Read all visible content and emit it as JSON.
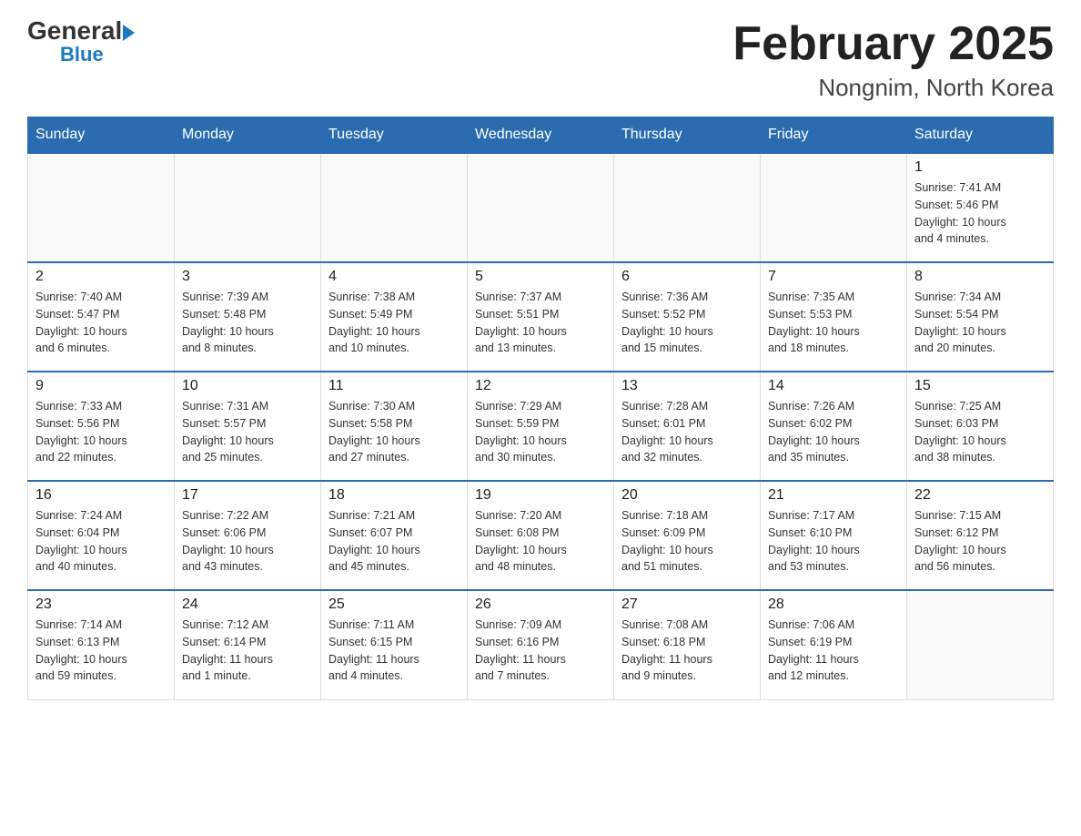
{
  "header": {
    "logo_general": "General",
    "logo_blue": "Blue",
    "month_title": "February 2025",
    "location": "Nongnim, North Korea"
  },
  "weekdays": [
    "Sunday",
    "Monday",
    "Tuesday",
    "Wednesday",
    "Thursday",
    "Friday",
    "Saturday"
  ],
  "weeks": [
    [
      {
        "day": "",
        "info": ""
      },
      {
        "day": "",
        "info": ""
      },
      {
        "day": "",
        "info": ""
      },
      {
        "day": "",
        "info": ""
      },
      {
        "day": "",
        "info": ""
      },
      {
        "day": "",
        "info": ""
      },
      {
        "day": "1",
        "info": "Sunrise: 7:41 AM\nSunset: 5:46 PM\nDaylight: 10 hours\nand 4 minutes."
      }
    ],
    [
      {
        "day": "2",
        "info": "Sunrise: 7:40 AM\nSunset: 5:47 PM\nDaylight: 10 hours\nand 6 minutes."
      },
      {
        "day": "3",
        "info": "Sunrise: 7:39 AM\nSunset: 5:48 PM\nDaylight: 10 hours\nand 8 minutes."
      },
      {
        "day": "4",
        "info": "Sunrise: 7:38 AM\nSunset: 5:49 PM\nDaylight: 10 hours\nand 10 minutes."
      },
      {
        "day": "5",
        "info": "Sunrise: 7:37 AM\nSunset: 5:51 PM\nDaylight: 10 hours\nand 13 minutes."
      },
      {
        "day": "6",
        "info": "Sunrise: 7:36 AM\nSunset: 5:52 PM\nDaylight: 10 hours\nand 15 minutes."
      },
      {
        "day": "7",
        "info": "Sunrise: 7:35 AM\nSunset: 5:53 PM\nDaylight: 10 hours\nand 18 minutes."
      },
      {
        "day": "8",
        "info": "Sunrise: 7:34 AM\nSunset: 5:54 PM\nDaylight: 10 hours\nand 20 minutes."
      }
    ],
    [
      {
        "day": "9",
        "info": "Sunrise: 7:33 AM\nSunset: 5:56 PM\nDaylight: 10 hours\nand 22 minutes."
      },
      {
        "day": "10",
        "info": "Sunrise: 7:31 AM\nSunset: 5:57 PM\nDaylight: 10 hours\nand 25 minutes."
      },
      {
        "day": "11",
        "info": "Sunrise: 7:30 AM\nSunset: 5:58 PM\nDaylight: 10 hours\nand 27 minutes."
      },
      {
        "day": "12",
        "info": "Sunrise: 7:29 AM\nSunset: 5:59 PM\nDaylight: 10 hours\nand 30 minutes."
      },
      {
        "day": "13",
        "info": "Sunrise: 7:28 AM\nSunset: 6:01 PM\nDaylight: 10 hours\nand 32 minutes."
      },
      {
        "day": "14",
        "info": "Sunrise: 7:26 AM\nSunset: 6:02 PM\nDaylight: 10 hours\nand 35 minutes."
      },
      {
        "day": "15",
        "info": "Sunrise: 7:25 AM\nSunset: 6:03 PM\nDaylight: 10 hours\nand 38 minutes."
      }
    ],
    [
      {
        "day": "16",
        "info": "Sunrise: 7:24 AM\nSunset: 6:04 PM\nDaylight: 10 hours\nand 40 minutes."
      },
      {
        "day": "17",
        "info": "Sunrise: 7:22 AM\nSunset: 6:06 PM\nDaylight: 10 hours\nand 43 minutes."
      },
      {
        "day": "18",
        "info": "Sunrise: 7:21 AM\nSunset: 6:07 PM\nDaylight: 10 hours\nand 45 minutes."
      },
      {
        "day": "19",
        "info": "Sunrise: 7:20 AM\nSunset: 6:08 PM\nDaylight: 10 hours\nand 48 minutes."
      },
      {
        "day": "20",
        "info": "Sunrise: 7:18 AM\nSunset: 6:09 PM\nDaylight: 10 hours\nand 51 minutes."
      },
      {
        "day": "21",
        "info": "Sunrise: 7:17 AM\nSunset: 6:10 PM\nDaylight: 10 hours\nand 53 minutes."
      },
      {
        "day": "22",
        "info": "Sunrise: 7:15 AM\nSunset: 6:12 PM\nDaylight: 10 hours\nand 56 minutes."
      }
    ],
    [
      {
        "day": "23",
        "info": "Sunrise: 7:14 AM\nSunset: 6:13 PM\nDaylight: 10 hours\nand 59 minutes."
      },
      {
        "day": "24",
        "info": "Sunrise: 7:12 AM\nSunset: 6:14 PM\nDaylight: 11 hours\nand 1 minute."
      },
      {
        "day": "25",
        "info": "Sunrise: 7:11 AM\nSunset: 6:15 PM\nDaylight: 11 hours\nand 4 minutes."
      },
      {
        "day": "26",
        "info": "Sunrise: 7:09 AM\nSunset: 6:16 PM\nDaylight: 11 hours\nand 7 minutes."
      },
      {
        "day": "27",
        "info": "Sunrise: 7:08 AM\nSunset: 6:18 PM\nDaylight: 11 hours\nand 9 minutes."
      },
      {
        "day": "28",
        "info": "Sunrise: 7:06 AM\nSunset: 6:19 PM\nDaylight: 11 hours\nand 12 minutes."
      },
      {
        "day": "",
        "info": ""
      }
    ]
  ]
}
